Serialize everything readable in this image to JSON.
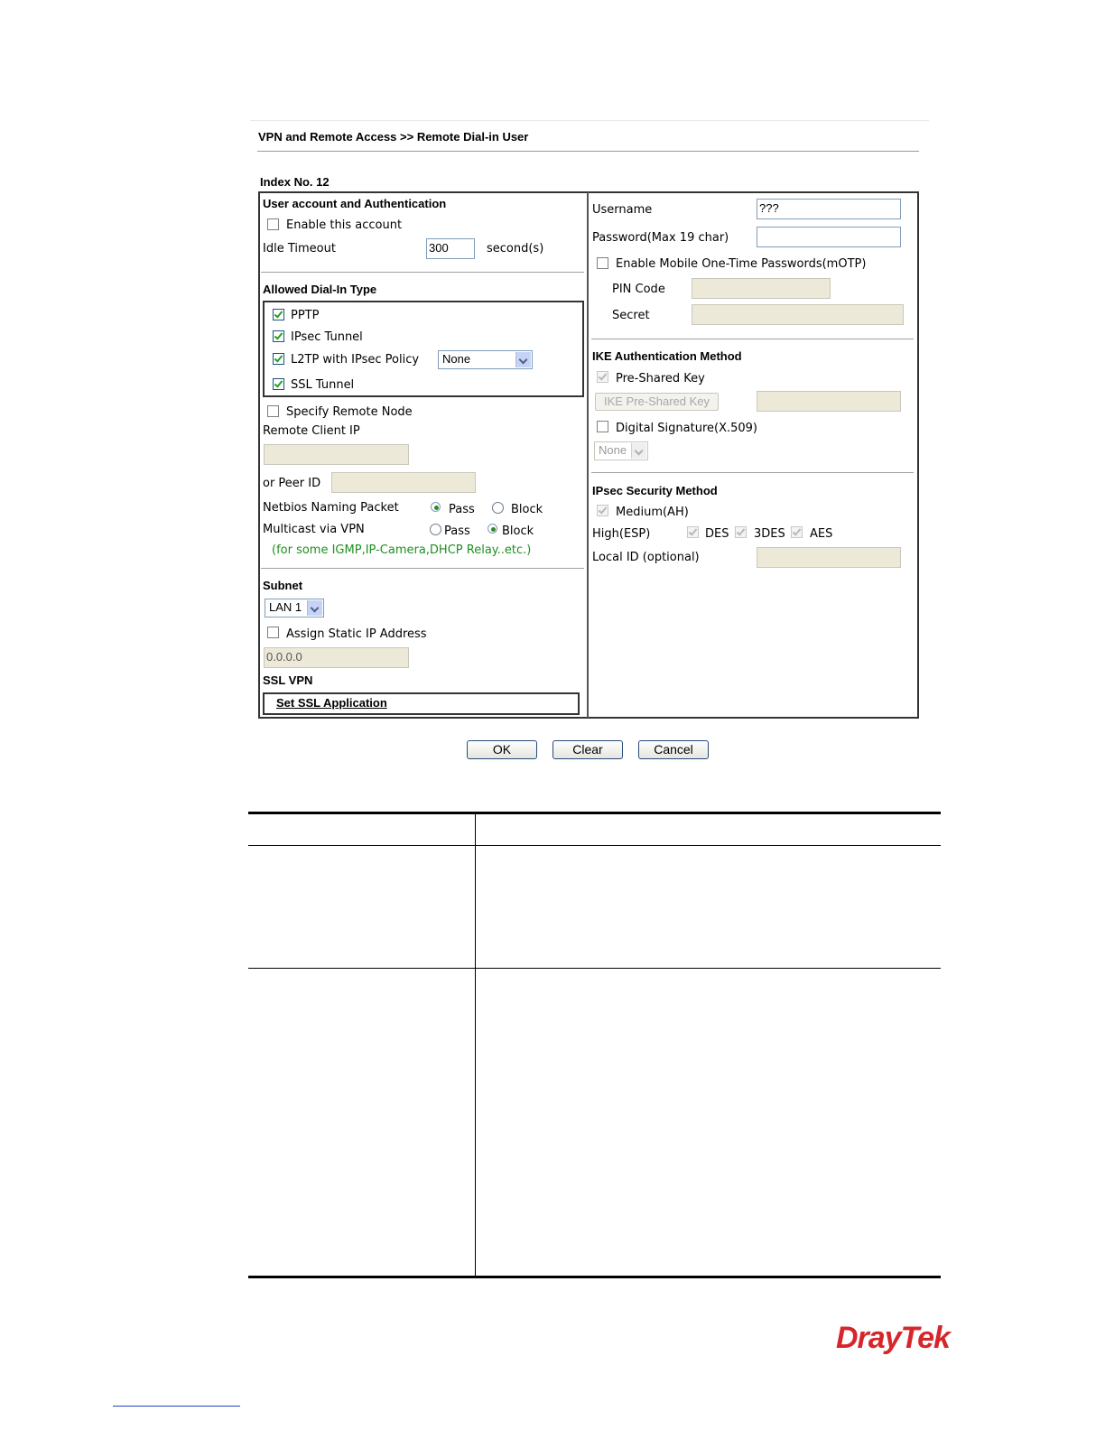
{
  "breadcrumb": "VPN and Remote Access >> Remote Dial-in User",
  "index_label": "Index No. 12",
  "left": {
    "account_heading": "User account and Authentication",
    "enable_account": {
      "label": "Enable this account",
      "checked": false
    },
    "idle_timeout": {
      "label": "Idle Timeout",
      "value": "300",
      "unit": "second(s)"
    },
    "dial_in_heading": "Allowed Dial-In Type",
    "dial_in_types": [
      {
        "label": "PPTP",
        "checked": true
      },
      {
        "label": "IPsec Tunnel",
        "checked": true
      },
      {
        "label": "L2TP with IPsec Policy",
        "checked": true
      },
      {
        "label": "SSL Tunnel",
        "checked": true
      }
    ],
    "l2tp_policy": "None",
    "specify_remote_node": {
      "label": "Specify Remote Node",
      "checked": false
    },
    "remote_client_ip_label": "Remote Client IP",
    "remote_client_ip_value": "",
    "peer_id_label": "or Peer ID",
    "peer_id_value": "",
    "netbios": {
      "label": "Netbios Naming Packet",
      "pass": "Pass",
      "block": "Block",
      "selected": "Pass"
    },
    "multicast": {
      "label": "Multicast via VPN",
      "pass": "Pass",
      "block": "Block",
      "selected": "Block"
    },
    "multicast_note": "(for some IGMP,IP-Camera,DHCP Relay..etc.)",
    "subnet_heading": "Subnet",
    "subnet_value": "LAN 1",
    "assign_static_ip": {
      "label": "Assign Static IP Address",
      "checked": false
    },
    "static_ip_value": "0.0.0.0",
    "ssl_vpn_heading": "SSL VPN",
    "ssl_app_link": "Set SSL Application"
  },
  "right": {
    "username": {
      "label": "Username",
      "value": "???"
    },
    "password": {
      "label": "Password(Max 19 char)",
      "value": ""
    },
    "motp": {
      "label": "Enable Mobile One-Time Passwords(mOTP)",
      "checked": false
    },
    "pin_code_label": "PIN Code",
    "secret_label": "Secret",
    "ike_heading": "IKE Authentication Method",
    "pre_shared_key": {
      "label": "Pre-Shared Key",
      "checked": true,
      "disabled": true
    },
    "ike_psk_button": "IKE Pre-Shared Key",
    "digital_signature": {
      "label": "Digital Signature(X.509)",
      "checked": false
    },
    "cert_select": "None",
    "ipsec_heading": "IPsec Security Method",
    "medium_ah": {
      "label": "Medium(AH)",
      "checked": true,
      "disabled": true
    },
    "high_esp_label": "High(ESP)",
    "esp_options": [
      {
        "label": "DES",
        "checked": true
      },
      {
        "label": "3DES",
        "checked": true
      },
      {
        "label": "AES",
        "checked": true
      }
    ],
    "local_id_label": "Local ID (optional)"
  },
  "buttons": {
    "ok": "OK",
    "clear": "Clear",
    "cancel": "Cancel"
  },
  "brand": "DrayTek",
  "colors": {
    "brand_red": "#d7262b",
    "note_green": "#1f8f1f",
    "panel_border": "#333333"
  }
}
